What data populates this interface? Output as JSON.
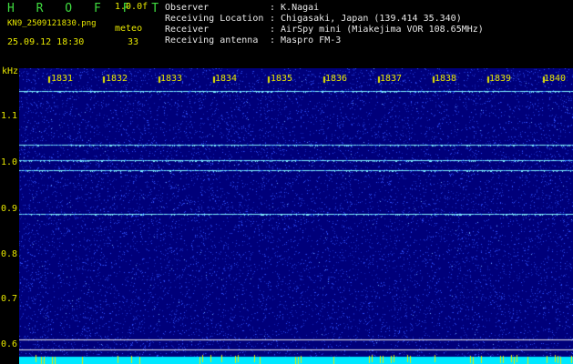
{
  "header": {
    "app_title": "H R O F F T",
    "version": "1.0.0f",
    "filename": "KN9_2509121830.png",
    "meteo_label": "meteo",
    "datetime": "25.09.12 18:30",
    "meteo_count": "33",
    "info": [
      {
        "label": "Observer",
        "value": ": K.Nagai"
      },
      {
        "label": "Receiving Location",
        "value": ": Chigasaki, Japan (139.414 35.340)"
      },
      {
        "label": "Receiver",
        "value": ": AirSpy mini (Miakejima VOR 108.65MHz)"
      },
      {
        "label": "Receiving antenna",
        "value": ": Maspro FM-3"
      }
    ]
  },
  "spectrogram": {
    "freq_unit": "kHz",
    "freq_labels": [
      "1.1",
      "1.0",
      "0.9",
      "0.8",
      "0.7",
      "0.6"
    ],
    "time_labels": [
      "1831",
      "1832",
      "1833",
      "1834",
      "1835",
      "1836",
      "1837",
      "1838",
      "1839",
      "1840"
    ],
    "freq_range_khz": [
      0.58,
      1.17
    ],
    "signal_lines_khz": [
      1.123,
      1.013,
      0.982,
      0.962,
      0.873
    ],
    "marker_lines_khz": [
      0.615,
      0.595
    ],
    "colors": {
      "background": "#00007a",
      "noise": "#3050ff",
      "signal": "#7ff0ff",
      "marker": "#e8e8e8",
      "bottom_bar": "#00e8ff",
      "label": "#e8e800"
    }
  }
}
